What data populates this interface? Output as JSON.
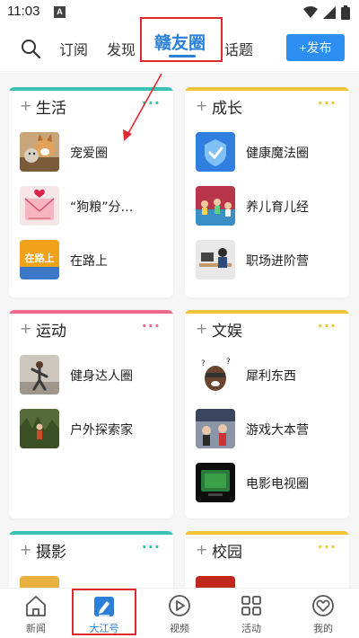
{
  "status": {
    "time": "11:03",
    "notification": "A"
  },
  "header": {
    "tabs": [
      "订阅",
      "发现",
      "赣友圈",
      "话题"
    ],
    "active_tab": "赣友圈",
    "publish_label": "+发布"
  },
  "cards": [
    {
      "title": "生活",
      "color": "#3cc2b4",
      "more": "···",
      "items": [
        {
          "label": "宠爱圈"
        },
        {
          "label": "“狗粮”分…"
        },
        {
          "label": "在路上"
        }
      ]
    },
    {
      "title": "成长",
      "color": "#f3c437",
      "more": "···",
      "items": [
        {
          "label": "健康魔法圈"
        },
        {
          "label": "养儿育儿经"
        },
        {
          "label": "职场进阶营"
        }
      ]
    },
    {
      "title": "运动",
      "color": "#ee6a8c",
      "more": "···",
      "items": [
        {
          "label": "健身达人圈"
        },
        {
          "label": "户外探索家"
        }
      ]
    },
    {
      "title": "文娱",
      "color": "#f3c437",
      "more": "···",
      "items": [
        {
          "label": "犀利东西"
        },
        {
          "label": "游戏大本营"
        },
        {
          "label": "电影电视圈"
        }
      ]
    },
    {
      "title": "摄影",
      "color": "#3cc2b4",
      "more": "···",
      "items": []
    },
    {
      "title": "校园",
      "color": "#f3c437",
      "more": "···",
      "items": []
    }
  ],
  "thumb_text": {
    "road": "在路上"
  },
  "bottom_nav": [
    {
      "label": "新闻",
      "icon": "house-icon"
    },
    {
      "label": "大江号",
      "icon": "pen-icon"
    },
    {
      "label": "视频",
      "icon": "play-icon"
    },
    {
      "label": "活动",
      "icon": "grid-icon"
    },
    {
      "label": "我的",
      "icon": "heart-icon"
    }
  ],
  "colors": {
    "accent_blue": "#2b7fd8",
    "highlight_red": "#e0292f"
  }
}
